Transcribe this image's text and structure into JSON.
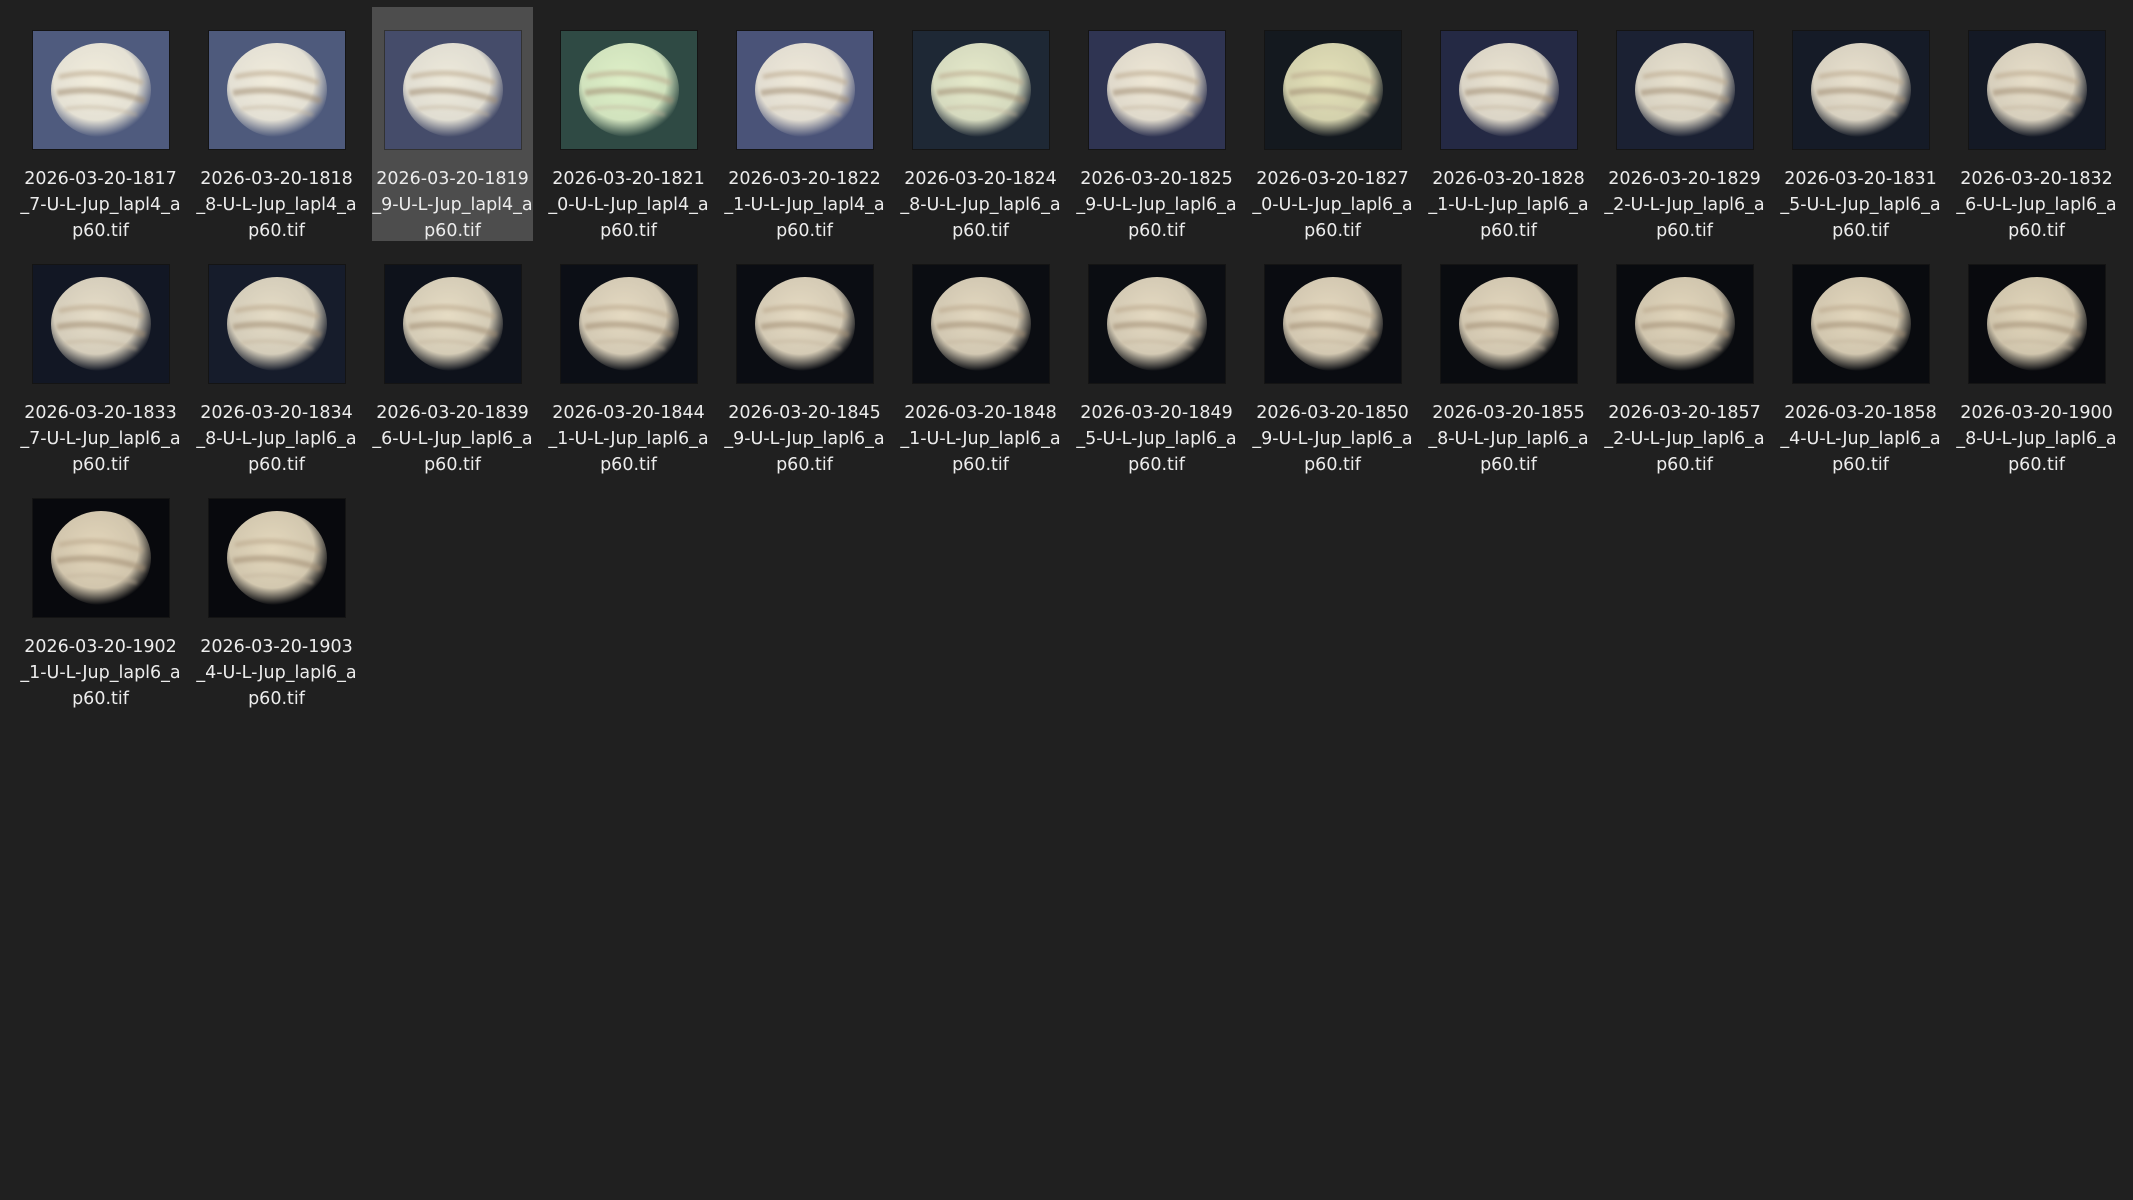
{
  "explorer": {
    "view": "large-icons",
    "selected_index": 2,
    "files": [
      {
        "name": "2026-03-20-1817_7-U-L-Jup_lapl4_ap60.tif",
        "thumb_bg": "#4f5b7e",
        "planet_tint": "#f2eddc",
        "icon": "jupiter-thumbnail-icon"
      },
      {
        "name": "2026-03-20-1818_8-U-L-Jup_lapl4_ap60.tif",
        "thumb_bg": "#4e5a7c",
        "planet_tint": "#f1ecdc",
        "icon": "jupiter-thumbnail-icon"
      },
      {
        "name": "2026-03-20-1819_9-U-L-Jup_lapl4_ap60.tif",
        "thumb_bg": "#454c6a",
        "planet_tint": "#eeeadb",
        "icon": "jupiter-thumbnail-icon"
      },
      {
        "name": "2026-03-20-1821_0-U-L-Jup_lapl4_ap60.tif",
        "thumb_bg": "#2f4a44",
        "planet_tint": "#dff0c8",
        "icon": "jupiter-thumbnail-icon"
      },
      {
        "name": "2026-03-20-1822_1-U-L-Jup_lapl4_ap60.tif",
        "thumb_bg": "#4a5378",
        "planet_tint": "#efe9d9",
        "icon": "jupiter-thumbnail-icon"
      },
      {
        "name": "2026-03-20-1824_8-U-L-Jup_lapl6_ap60.tif",
        "thumb_bg": "#1e2835",
        "planet_tint": "#e6eacb",
        "icon": "jupiter-thumbnail-icon"
      },
      {
        "name": "2026-03-20-1825_9-U-L-Jup_lapl6_ap60.tif",
        "thumb_bg": "#2f3452",
        "planet_tint": "#efe8d6",
        "icon": "jupiter-thumbnail-icon"
      },
      {
        "name": "2026-03-20-1827_0-U-L-Jup_lapl6_ap60.tif",
        "thumb_bg": "#14191f",
        "planet_tint": "#e4e1b9",
        "icon": "jupiter-thumbnail-icon"
      },
      {
        "name": "2026-03-20-1828_1-U-L-Jup_lapl6_ap60.tif",
        "thumb_bg": "#242944",
        "planet_tint": "#ebe4d2",
        "icon": "jupiter-thumbnail-icon"
      },
      {
        "name": "2026-03-20-1829_2-U-L-Jup_lapl6_ap60.tif",
        "thumb_bg": "#1b2133",
        "planet_tint": "#e9e2cf",
        "icon": "jupiter-thumbnail-icon"
      },
      {
        "name": "2026-03-20-1831_5-U-L-Jup_lapl6_ap60.tif",
        "thumb_bg": "#151b27",
        "planet_tint": "#e9e1ce",
        "icon": "jupiter-thumbnail-icon"
      },
      {
        "name": "2026-03-20-1832_6-U-L-Jup_lapl6_ap60.tif",
        "thumb_bg": "#141925",
        "planet_tint": "#e8dfca",
        "icon": "jupiter-thumbnail-icon"
      },
      {
        "name": "2026-03-20-1833_7-U-L-Jup_lapl6_ap60.tif",
        "thumb_bg": "#121724",
        "planet_tint": "#e6ddc8",
        "icon": "jupiter-thumbnail-icon"
      },
      {
        "name": "2026-03-20-1834_8-U-L-Jup_lapl6_ap60.tif",
        "thumb_bg": "#161c2b",
        "planet_tint": "#e5dcc6",
        "icon": "jupiter-thumbnail-icon"
      },
      {
        "name": "2026-03-20-1839_6-U-L-Jup_lapl6_ap60.tif",
        "thumb_bg": "#0e121b",
        "planet_tint": "#e6dcc4",
        "icon": "jupiter-thumbnail-icon"
      },
      {
        "name": "2026-03-20-1844_1-U-L-Jup_lapl6_ap60.tif",
        "thumb_bg": "#0c0f16",
        "planet_tint": "#e5dac2",
        "icon": "jupiter-thumbnail-icon"
      },
      {
        "name": "2026-03-20-1845_9-U-L-Jup_lapl6_ap60.tif",
        "thumb_bg": "#0b0d13",
        "planet_tint": "#e6dbc3",
        "icon": "jupiter-thumbnail-icon"
      },
      {
        "name": "2026-03-20-1848_1-U-L-Jup_lapl6_ap60.tif",
        "thumb_bg": "#0b0d12",
        "planet_tint": "#e3d8c0",
        "icon": "jupiter-thumbnail-icon"
      },
      {
        "name": "2026-03-20-1849_5-U-L-Jup_lapl6_ap60.tif",
        "thumb_bg": "#0b0d12",
        "planet_tint": "#e5dac2",
        "icon": "jupiter-thumbnail-icon"
      },
      {
        "name": "2026-03-20-1850_9-U-L-Jup_lapl6_ap60.tif",
        "thumb_bg": "#0a0c11",
        "planet_tint": "#e4d8bf",
        "icon": "jupiter-thumbnail-icon"
      },
      {
        "name": "2026-03-20-1855_8-U-L-Jup_lapl6_ap60.tif",
        "thumb_bg": "#0a0c10",
        "planet_tint": "#e3d7be",
        "icon": "jupiter-thumbnail-icon"
      },
      {
        "name": "2026-03-20-1857_2-U-L-Jup_lapl6_ap60.tif",
        "thumb_bg": "#090b0f",
        "planet_tint": "#e2d6bc",
        "icon": "jupiter-thumbnail-icon"
      },
      {
        "name": "2026-03-20-1858_4-U-L-Jup_lapl6_ap60.tif",
        "thumb_bg": "#090b0f",
        "planet_tint": "#e3d7bd",
        "icon": "jupiter-thumbnail-icon"
      },
      {
        "name": "2026-03-20-1900_8-U-L-Jup_lapl6_ap60.tif",
        "thumb_bg": "#090a0e",
        "planet_tint": "#e2d6bb",
        "icon": "jupiter-thumbnail-icon"
      },
      {
        "name": "2026-03-20-1902_1-U-L-Jup_lapl6_ap60.tif",
        "thumb_bg": "#08090d",
        "planet_tint": "#e3d6bb",
        "icon": "jupiter-thumbnail-icon"
      },
      {
        "name": "2026-03-20-1903_4-U-L-Jup_lapl6_ap60.tif",
        "thumb_bg": "#08090d",
        "planet_tint": "#e4d8bd",
        "icon": "jupiter-thumbnail-icon"
      }
    ]
  }
}
